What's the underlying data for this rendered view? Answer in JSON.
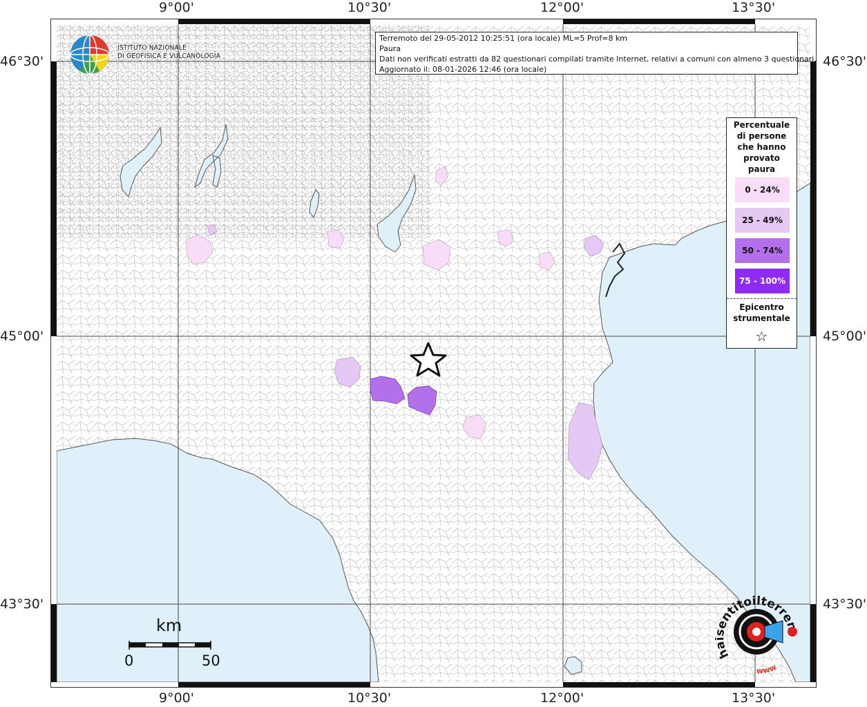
{
  "info": {
    "line1": "Terremoto del 29-05-2012 10:25:51 (ora locale) ML=5 Prof=8 km",
    "line2": "Paura",
    "line3": "Dati non verificati estratti da 82 questionari compilati tramite Internet, relativi a comuni con almeno 3 questionari.",
    "line4": "Aggiornato il: 08-01-2026 12:46 (ora locale)"
  },
  "coords": {
    "top": [
      "9°00'",
      "10°30'",
      "12°00'",
      "13°30'"
    ],
    "bottom": [
      "9°00'",
      "10°30'",
      "12°00'",
      "13°30'"
    ],
    "left": [
      "46°30'",
      "45°00'",
      "43°30'"
    ],
    "right": [
      "46°30'",
      "45°00'",
      "43°30'"
    ]
  },
  "logo": {
    "line1": "ISTITUTO NAZIONALE",
    "line2": "DI GEOFISICA E VULCANOLOGIA"
  },
  "legend": {
    "title": [
      "Percentuale",
      "di persone",
      "che hanno",
      "provato",
      "paura"
    ],
    "classes": [
      {
        "label": "0 - 24%",
        "color": "#f9dcf7"
      },
      {
        "label": "25 - 49%",
        "color": "#e6c8f4"
      },
      {
        "label": "50 - 74%",
        "color": "#b270ea"
      },
      {
        "label": "75 - 100%",
        "color": "#8f2bf3"
      }
    ],
    "epicenter_title": [
      "Epicentro",
      "strumentale"
    ],
    "epicenter_symbol": "☆"
  },
  "scale": {
    "title": "km",
    "min": "0",
    "max": "50"
  },
  "badge": {
    "arc_top": "haisentitoilterremoto.it",
    "arc_bottom": "www"
  },
  "colors": {
    "sea": "#dff0fb",
    "border": "#9a9a9a",
    "grid": "#444444"
  }
}
